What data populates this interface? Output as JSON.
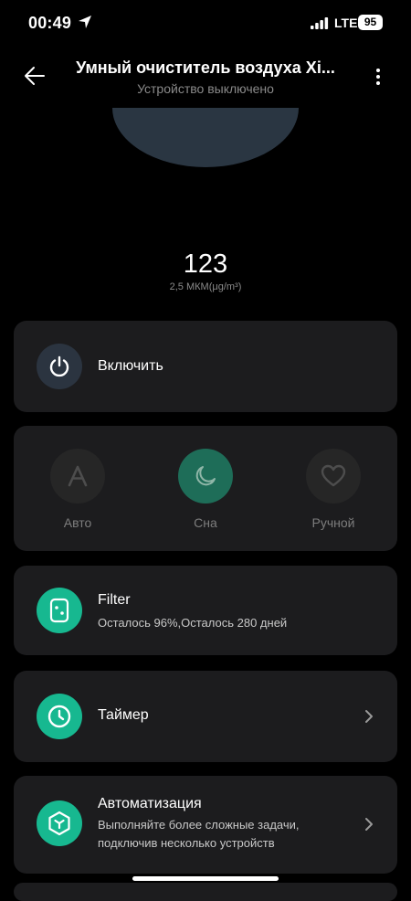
{
  "status_bar": {
    "time": "00:49",
    "network": "LTE",
    "battery": "95"
  },
  "header": {
    "title": "Умный очиститель воздуха Xi...",
    "subtitle": "Устройство выключено"
  },
  "air_quality": {
    "value": "123",
    "unit": "2,5 МКМ(μg/m³)"
  },
  "power": {
    "label": "Включить"
  },
  "modes": [
    {
      "label": "Авто",
      "icon": "letter-a-icon",
      "active": false
    },
    {
      "label": "Сна",
      "icon": "moon-icon",
      "active": true
    },
    {
      "label": "Ручной",
      "icon": "heart-icon",
      "active": false
    }
  ],
  "filter": {
    "title": "Filter",
    "status": "Осталось 96%,Осталось 280 дней"
  },
  "timer": {
    "title": "Таймер"
  },
  "automation": {
    "title": "Автоматизация",
    "description_line1": "Выполняйте более сложные задачи,",
    "description_line2": "подключив несколько устройств"
  },
  "colors": {
    "accent": "#17b890",
    "card": "#1c1c1e",
    "background": "#000000",
    "device": "#2a3642"
  }
}
